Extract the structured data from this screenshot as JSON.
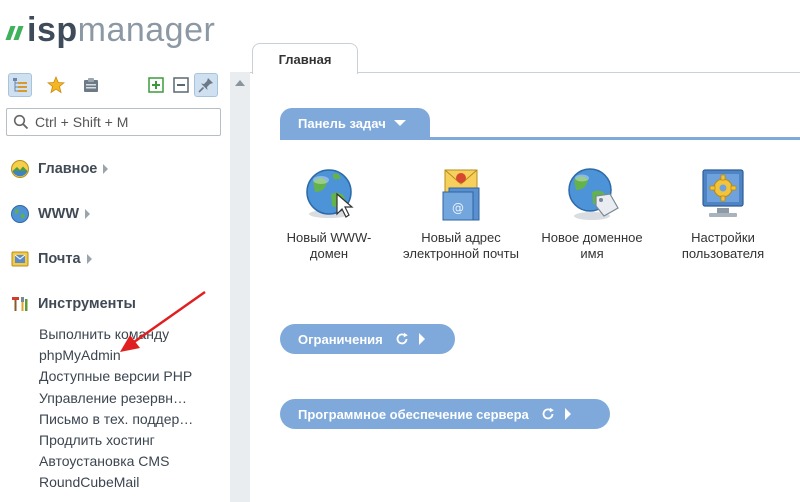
{
  "logo": {
    "part1": "isp",
    "part2": "manager"
  },
  "search": {
    "placeholder": "Ctrl + Shift + M"
  },
  "nav": {
    "groups": [
      {
        "label": "Главное"
      },
      {
        "label": "WWW"
      },
      {
        "label": "Почта"
      },
      {
        "label": "Инструменты"
      }
    ],
    "tools": [
      "Выполнить команду",
      "phpMyAdmin",
      "Доступные версии PHP",
      "Управление резервн…",
      "Письмо в тех. поддер…",
      "Продлить хостинг",
      "Автоустановка CMS",
      "RoundCubeMail"
    ]
  },
  "tabs": [
    {
      "label": "Главная"
    }
  ],
  "main": {
    "tasks_title": "Панель задач",
    "tasks": [
      {
        "label": "Новый WWW-домен",
        "icon": "globe-cursor-icon"
      },
      {
        "label": "Новый адрес электронной почты",
        "icon": "mail-address-icon"
      },
      {
        "label": "Новое доменное имя",
        "icon": "globe-tag-icon"
      },
      {
        "label": "Настройки пользователя",
        "icon": "monitor-gear-icon"
      }
    ],
    "limits_title": "Ограничения",
    "software_title": "Программное обеспечение сервера"
  },
  "colors": {
    "accent": "#7ea9da",
    "logo_green": "#3fb15a",
    "annotation": "#e02020"
  }
}
